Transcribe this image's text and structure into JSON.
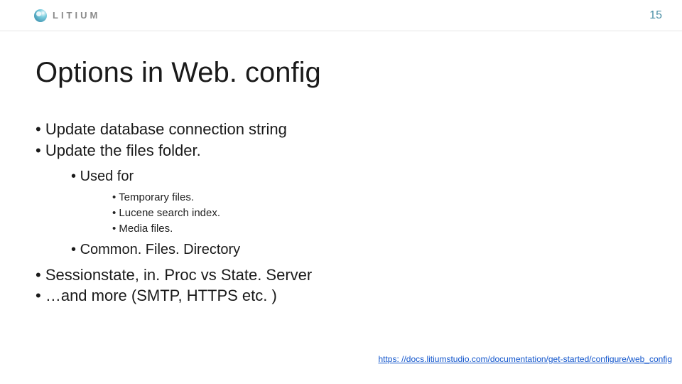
{
  "header": {
    "brand": "LITIUM",
    "page_number": "15"
  },
  "title": "Options in Web. config",
  "bullets": {
    "b1": "Update database connection string",
    "b2": "Update the files folder.",
    "b2_sub1": "Used for",
    "b2_sub1_a": "Temporary files.",
    "b2_sub1_b": "Lucene search index.",
    "b2_sub1_c": "Media files.",
    "b2_sub2": "Common. Files. Directory",
    "b3": "Sessionstate, in. Proc vs State. Server",
    "b4": "…and more (SMTP, HTTPS etc. )"
  },
  "footer": {
    "link_text": "https: //docs.litiumstudio.com/documentation/get-started/configure/web_config",
    "link_href": "https://docs.litiumstudio.com/documentation/get-started/configure/web_config"
  }
}
